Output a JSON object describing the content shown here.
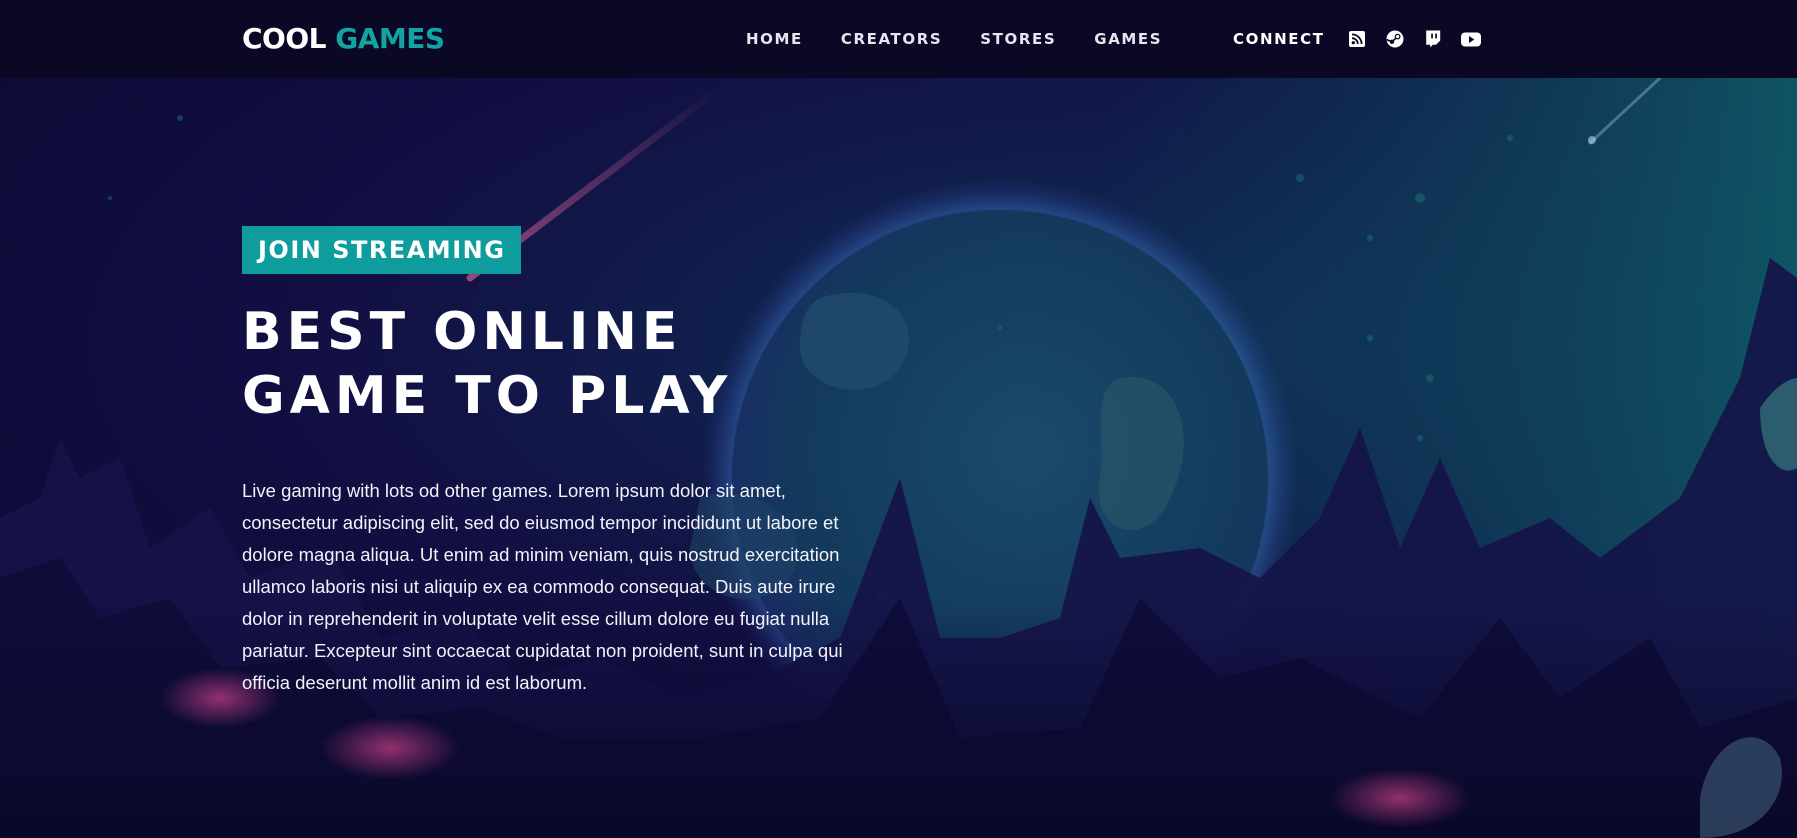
{
  "brand": {
    "word1": "COOL",
    "word2": "GAMES",
    "accent_color": "#13a3a3"
  },
  "nav": {
    "items": [
      "HOME",
      "CREATORS",
      "STORES",
      "GAMES"
    ]
  },
  "header": {
    "connect_label": "CONNECT",
    "socials": [
      "rss-icon",
      "steam-icon",
      "twitch-icon",
      "youtube-icon"
    ]
  },
  "hero": {
    "badge": "JOIN STREAMING",
    "badge_color": "#0e9c9c",
    "title_line1": "BEST ONLINE",
    "title_line2": "GAME TO PLAY",
    "description": "Live gaming with lots od other games. Lorem ipsum dolor sit amet, consectetur adipiscing elit, sed do eiusmod tempor incididunt ut labore et dolore magna aliqua. Ut enim ad minim veniam, quis nostrud exercitation ullamco laboris nisi ut aliquip ex ea commodo consequat. Duis aute irure dolor in reprehenderit in voluptate velit esse cillum dolore eu fugiat nulla pariatur. Excepteur sint occaecat cupidatat non proident, sunt in culpa qui officia deserunt mollit anim id est laborum."
  },
  "colors": {
    "header_bg": "#0a0825",
    "hero_bg": "#0f0a33"
  }
}
